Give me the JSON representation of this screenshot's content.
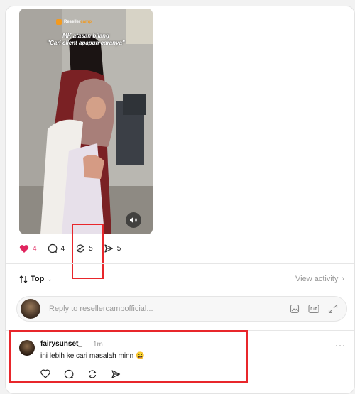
{
  "post": {
    "brand": {
      "prefix": "Reseller",
      "suffix": "camp"
    },
    "caption_line1": "MK atasan bilang",
    "caption_line2": "\"Cari client apapun caranya\"",
    "likes": "4",
    "comments": "4",
    "reposts": "5",
    "shares": "5"
  },
  "sort": {
    "label": "Top",
    "view_activity": "View activity"
  },
  "reply": {
    "placeholder": "Reply to resellercampofficial..."
  },
  "comment": {
    "username": "fairysunset_",
    "time": "1m",
    "text": "ini lebih ke cari masalah minn 😄",
    "more": "···"
  },
  "colors": {
    "like": "#e0245e",
    "highlight": "#e8262b"
  }
}
